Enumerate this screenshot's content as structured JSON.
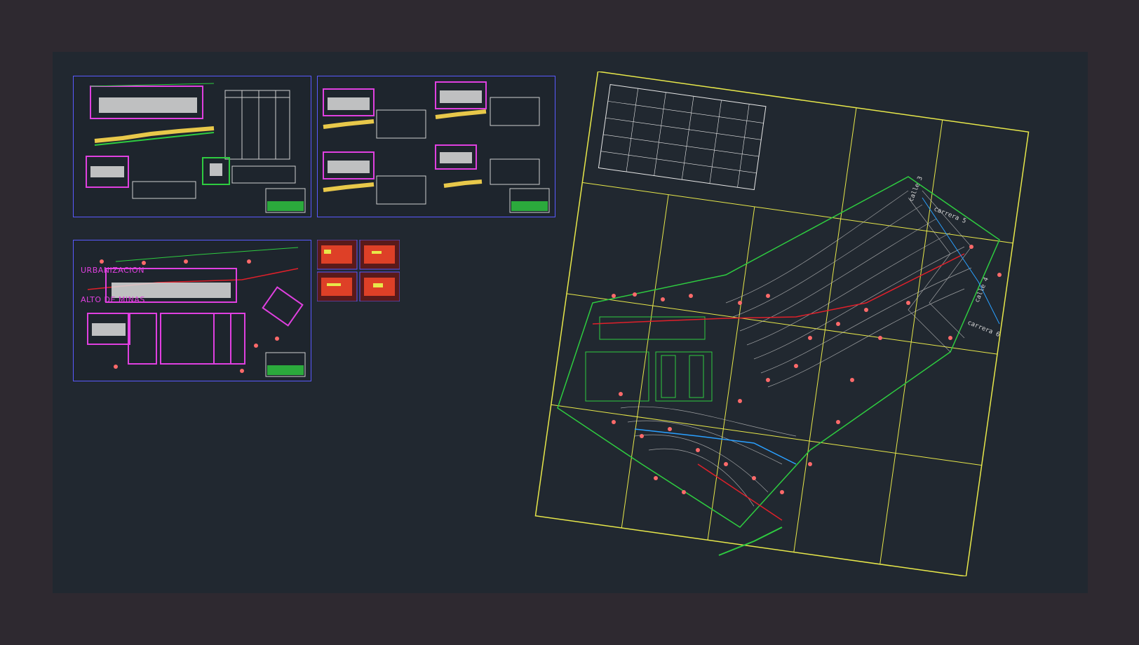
{
  "project_title": {
    "line1": "URBANIZACION",
    "line2": "ALTO DE MINAS"
  },
  "road_labels": {
    "calle_3": "calle 3",
    "calle_4": "calle 4",
    "carrera_5": "carrera 5",
    "carrera_6": "carrera 6"
  },
  "colors": {
    "background": "#2e2930",
    "model_space": "#212830",
    "sheet_border": "#5a5aff",
    "grid_lines": "#e8e84a",
    "contours": "#c8c8c8",
    "lot_outlines": "#2ecc40",
    "boundary_magenta": "#e040e0",
    "trees": "#ff6a6a",
    "water": "#2aa0ff",
    "road_red": "#e0202a"
  },
  "icons": {
    "tree": "tree-symbol-icon",
    "north": "north-arrow-icon"
  }
}
